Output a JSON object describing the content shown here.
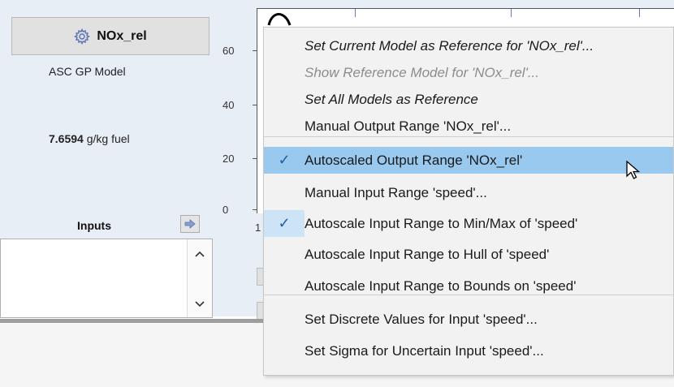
{
  "model_panel": {
    "button_label": "NOx_rel",
    "model_name": "ASC GP Model",
    "value": "7.6594",
    "unit": "g/kg fuel"
  },
  "plot": {
    "y_ticks": [
      "60",
      "40",
      "20",
      "0"
    ],
    "x_tick": "1"
  },
  "inputs": {
    "title": "Inputs"
  },
  "context_menu": {
    "items": [
      {
        "label": "Set Current Model as Reference for 'NOx_rel'...",
        "style": "italic",
        "checked": false,
        "highlighted": false,
        "disabled": false
      },
      {
        "label": "Show Reference Model for 'NOx_rel'...",
        "style": "italic",
        "checked": false,
        "highlighted": false,
        "disabled": true
      },
      {
        "label": "Set All Models as Reference",
        "style": "italic",
        "checked": false,
        "highlighted": false,
        "disabled": false
      },
      {
        "label": "Manual Output Range 'NOx_rel'...",
        "style": "normal",
        "checked": false,
        "highlighted": false,
        "disabled": false
      },
      {
        "label": "Autoscaled Output Range 'NOx_rel'",
        "style": "normal",
        "checked": true,
        "highlighted": true,
        "disabled": false
      },
      {
        "label": "Manual Input Range 'speed'...",
        "style": "normal",
        "checked": false,
        "highlighted": false,
        "disabled": false
      },
      {
        "label": "Autoscale Input Range to Min/Max of 'speed'",
        "style": "normal",
        "checked": true,
        "highlighted": false,
        "disabled": false
      },
      {
        "label": "Autoscale Input Range to Hull of 'speed'",
        "style": "normal",
        "checked": false,
        "highlighted": false,
        "disabled": false
      },
      {
        "label": "Autoscale Input Range to Bounds on 'speed'",
        "style": "normal",
        "checked": false,
        "highlighted": false,
        "disabled": false
      },
      {
        "label": "Set Discrete Values for Input 'speed'...",
        "style": "normal",
        "checked": false,
        "highlighted": false,
        "disabled": false
      },
      {
        "label": "Set Sigma for Uncertain Input 'speed'...",
        "style": "normal",
        "checked": false,
        "highlighted": false,
        "disabled": false
      }
    ],
    "check_glyph": "✓"
  },
  "colors": {
    "highlight": "#99c9ef",
    "check": "#1e5fa8",
    "panel_bg": "#e8eef6"
  }
}
